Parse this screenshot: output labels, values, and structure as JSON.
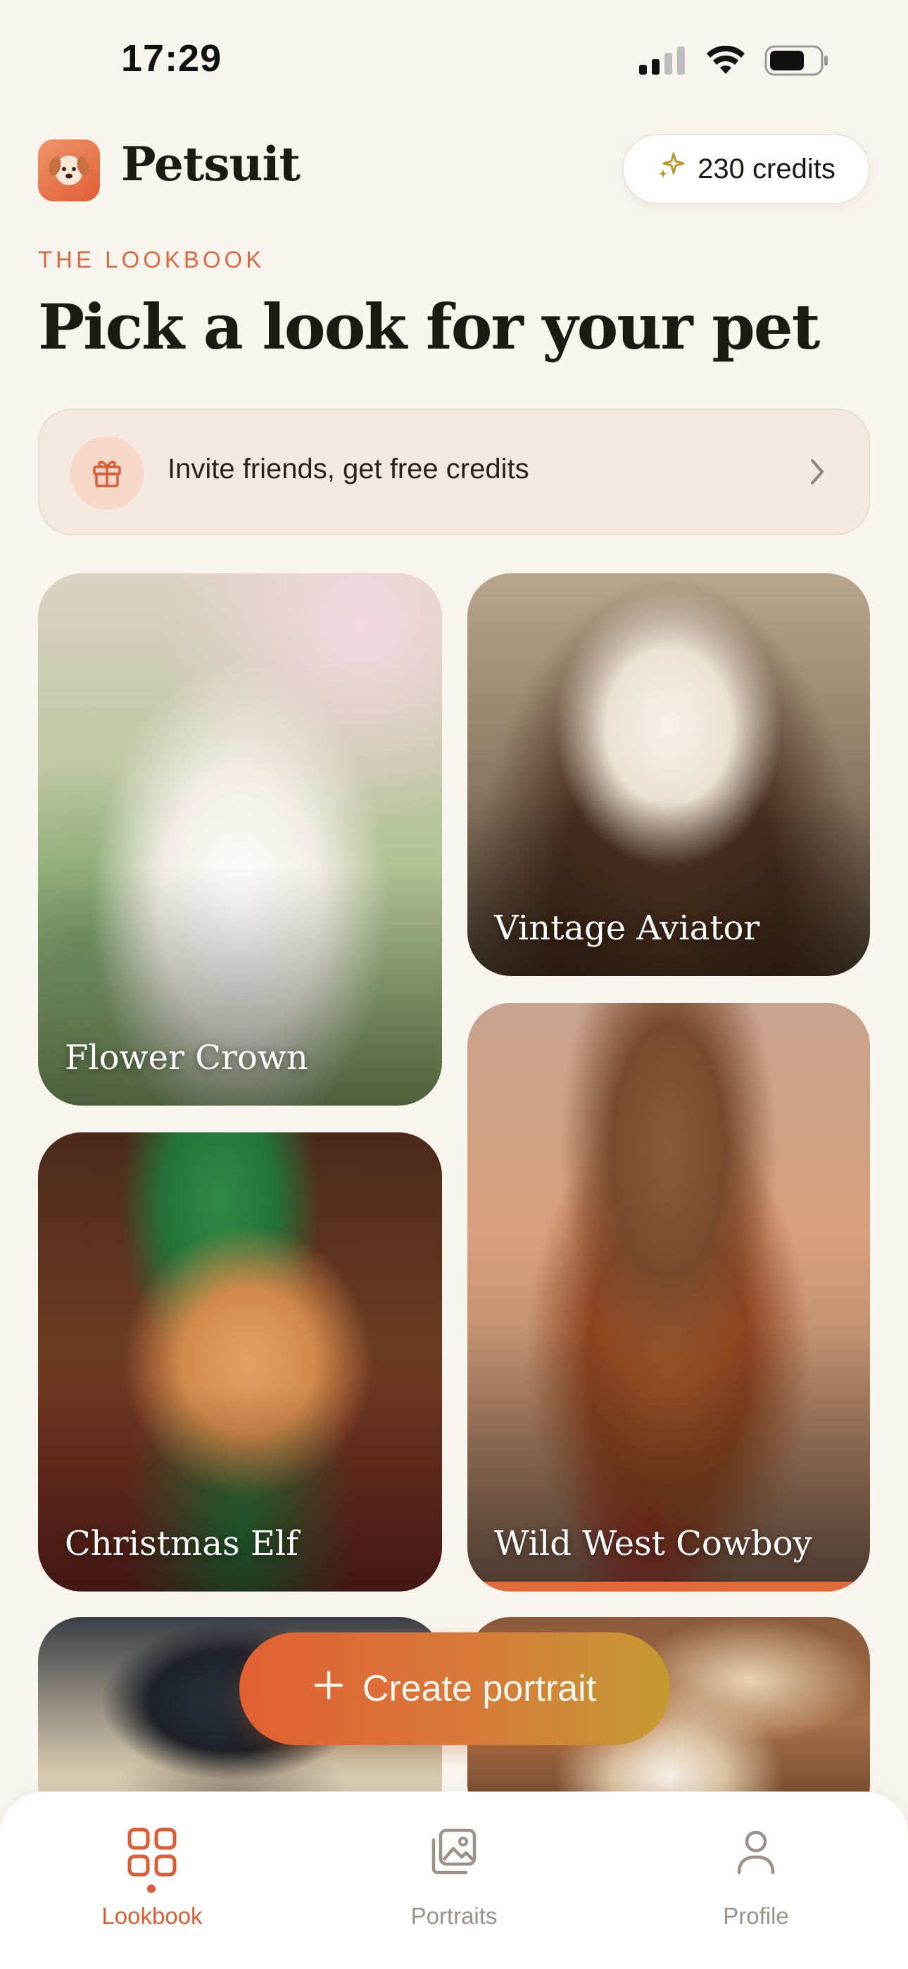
{
  "status_bar": {
    "time": "17:29"
  },
  "header": {
    "brand": "Petsuit",
    "credits_label": "230 credits"
  },
  "hero": {
    "eyebrow": "THE LOOKBOOK",
    "title": "Pick a look for your pet"
  },
  "invite_banner": {
    "label": "Invite friends, get free credits"
  },
  "looks": [
    {
      "label": "Flower Crown"
    },
    {
      "label": "Vintage Aviator"
    },
    {
      "label": "Christmas Elf"
    },
    {
      "label": "Wild West Cowboy"
    }
  ],
  "create_button": {
    "label": "Create portrait"
  },
  "tabs": [
    {
      "label": "Lookbook",
      "active": true
    },
    {
      "label": "Portraits",
      "active": false
    },
    {
      "label": "Profile",
      "active": false
    }
  ],
  "colors": {
    "accent": "#db5d33",
    "background": "#f8f5ef",
    "tab_inactive": "#9c9088"
  },
  "icons": [
    "cellular-signal-icon",
    "wifi-icon",
    "battery-icon",
    "dog-logo-icon",
    "sparkle-icon",
    "gift-icon",
    "chevron-right-icon",
    "plus-icon",
    "grid-icon",
    "gallery-icon",
    "person-icon"
  ]
}
